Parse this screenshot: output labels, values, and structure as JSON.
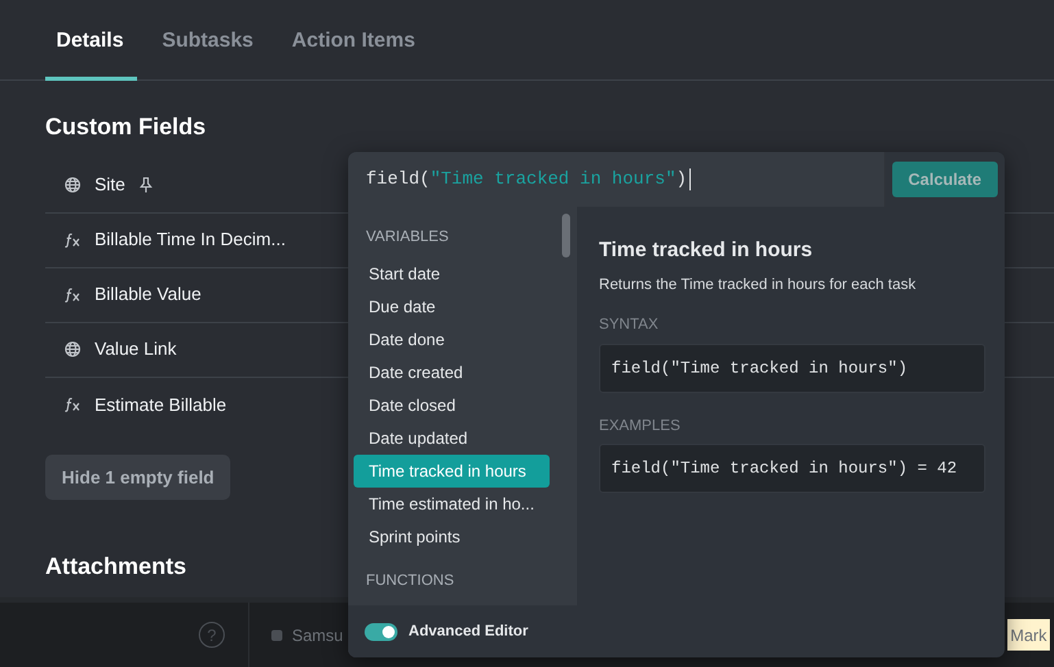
{
  "tabs": [
    {
      "label": "Details",
      "selected": true
    },
    {
      "label": "Subtasks",
      "selected": false
    },
    {
      "label": "Action Items",
      "selected": false
    }
  ],
  "custom_fields": {
    "title": "Custom Fields",
    "items": [
      {
        "kind": "link",
        "label": "Site",
        "pinned": true
      },
      {
        "kind": "formula",
        "label": "Billable Time In Decim...",
        "pinned": false
      },
      {
        "kind": "formula",
        "label": "Billable Value",
        "pinned": false
      },
      {
        "kind": "link",
        "label": "Value Link",
        "pinned": false
      },
      {
        "kind": "formula",
        "label": "Estimate Billable",
        "pinned": false
      }
    ],
    "hide_button": "Hide 1 empty field"
  },
  "attachments": {
    "title": "Attachments"
  },
  "bottom_bar": {
    "help": "?",
    "item": "Samsu",
    "item_checked": false,
    "right_text": "Mark"
  },
  "formula_editor": {
    "formula": [
      {
        "kind": "code",
        "text": "field("
      },
      {
        "kind": "string",
        "text": "\"Time tracked in hours\""
      },
      {
        "kind": "code",
        "text": ")"
      }
    ],
    "calculate_button": "Calculate",
    "groups": [
      {
        "title": "VARIABLES",
        "items": [
          {
            "label": "Start date",
            "selected": false
          },
          {
            "label": "Due date",
            "selected": false
          },
          {
            "label": "Date done",
            "selected": false
          },
          {
            "label": "Date created",
            "selected": false
          },
          {
            "label": "Date closed",
            "selected": false
          },
          {
            "label": "Date updated",
            "selected": false
          },
          {
            "label": "Time tracked in hours",
            "selected": true
          },
          {
            "label": "Time estimated in ho...",
            "selected": false
          },
          {
            "label": "Sprint points",
            "selected": false
          }
        ]
      },
      {
        "title": "FUNCTIONS"
      }
    ],
    "detail": {
      "title": "Time tracked in hours",
      "description": "Returns the Time tracked in hours for each task",
      "syntax_label": "SYNTAX",
      "syntax": "field(\"Time tracked in hours\")",
      "examples_label": "EXAMPLES",
      "example": "field(\"Time tracked in hours\") = 42"
    },
    "advanced_editor": {
      "label": "Advanced Editor",
      "on": true
    }
  }
}
